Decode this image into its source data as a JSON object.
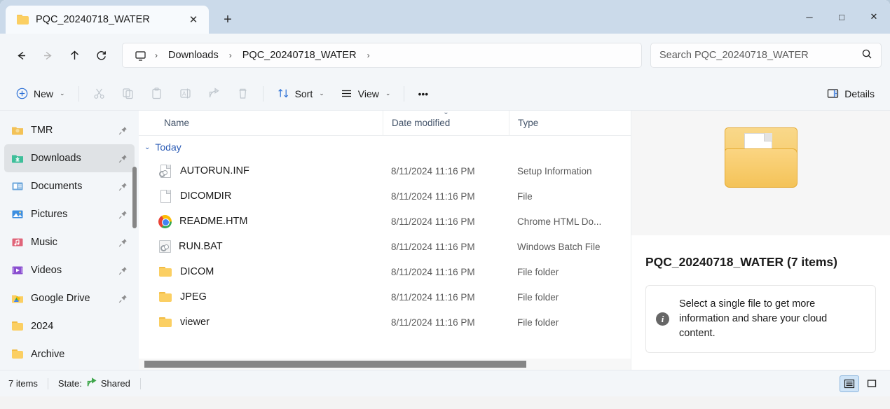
{
  "window": {
    "tab_title": "PQC_20240718_WATER",
    "tab_close_label": "✕",
    "new_tab_label": "+",
    "minimize_label": "─",
    "maximize_label": "□",
    "close_label": "✕"
  },
  "navigation": {
    "back_label": "←",
    "forward_label": "→",
    "up_label": "↑",
    "refresh_label": "⟳",
    "breadcrumbs": [
      {
        "label": "Downloads"
      },
      {
        "label": "PQC_20240718_WATER"
      }
    ],
    "separator": "›",
    "trailing_separator": "›"
  },
  "search": {
    "placeholder": "Search PQC_20240718_WATER",
    "value": ""
  },
  "toolbar": {
    "new_label": "New",
    "cut_label": "Cut",
    "copy_label": "Copy",
    "paste_label": "Paste",
    "rename_label": "Rename",
    "share_label": "Share",
    "delete_label": "Delete",
    "sort_label": "Sort",
    "view_label": "View",
    "more_label": "•••",
    "details_label": "Details",
    "chevron": "⌄"
  },
  "sidebar": {
    "items": [
      {
        "label": "TMR",
        "icon": "folder-icon",
        "pinned": true,
        "selected": false
      },
      {
        "label": "Downloads",
        "icon": "downloads-icon",
        "pinned": true,
        "selected": true
      },
      {
        "label": "Documents",
        "icon": "documents-icon",
        "pinned": true,
        "selected": false
      },
      {
        "label": "Pictures",
        "icon": "pictures-icon",
        "pinned": true,
        "selected": false
      },
      {
        "label": "Music",
        "icon": "music-icon",
        "pinned": true,
        "selected": false
      },
      {
        "label": "Videos",
        "icon": "videos-icon",
        "pinned": true,
        "selected": false
      },
      {
        "label": "Google Drive",
        "icon": "google-drive-icon",
        "pinned": true,
        "selected": false
      },
      {
        "label": "2024",
        "icon": "folder-icon",
        "pinned": false,
        "selected": false
      },
      {
        "label": "Archive",
        "icon": "folder-icon",
        "pinned": false,
        "selected": false
      }
    ]
  },
  "filelist": {
    "columns": [
      {
        "label": "Name",
        "sorted": false
      },
      {
        "label": "Date modified",
        "sorted": true
      },
      {
        "label": "Type",
        "sorted": false
      }
    ],
    "group_header": "Today",
    "group_chevron": "⌄",
    "rows": [
      {
        "name": "AUTORUN.INF",
        "date": "8/11/2024 11:16 PM",
        "type": "Setup Information",
        "icon": "inf-file-icon"
      },
      {
        "name": "DICOMDIR",
        "date": "8/11/2024 11:16 PM",
        "type": "File",
        "icon": "generic-file-icon"
      },
      {
        "name": "README.HTM",
        "date": "8/11/2024 11:16 PM",
        "type": "Chrome HTML Do...",
        "icon": "chrome-icon"
      },
      {
        "name": "RUN.BAT",
        "date": "8/11/2024 11:16 PM",
        "type": "Windows Batch File",
        "icon": "batch-file-icon"
      },
      {
        "name": "DICOM",
        "date": "8/11/2024 11:16 PM",
        "type": "File folder",
        "icon": "folder-icon"
      },
      {
        "name": "JPEG",
        "date": "8/11/2024 11:16 PM",
        "type": "File folder",
        "icon": "folder-icon"
      },
      {
        "name": "viewer",
        "date": "8/11/2024 11:16 PM",
        "type": "File folder",
        "icon": "folder-icon"
      }
    ]
  },
  "details_pane": {
    "title": "PQC_20240718_WATER (7 items)",
    "info_icon": "i",
    "info_text": "Select a single file to get more information and share your cloud content."
  },
  "statusbar": {
    "item_count": "7 items",
    "state_label": "State:",
    "state_value": "Shared",
    "details_view_label": "Details view",
    "large_icons_view_label": "Large icons view"
  },
  "colors": {
    "accent": "#2b5bb5",
    "titlebar": "#cbdaea",
    "folder_yellow": "#fbcf63",
    "shared_green": "#3ea64a"
  }
}
